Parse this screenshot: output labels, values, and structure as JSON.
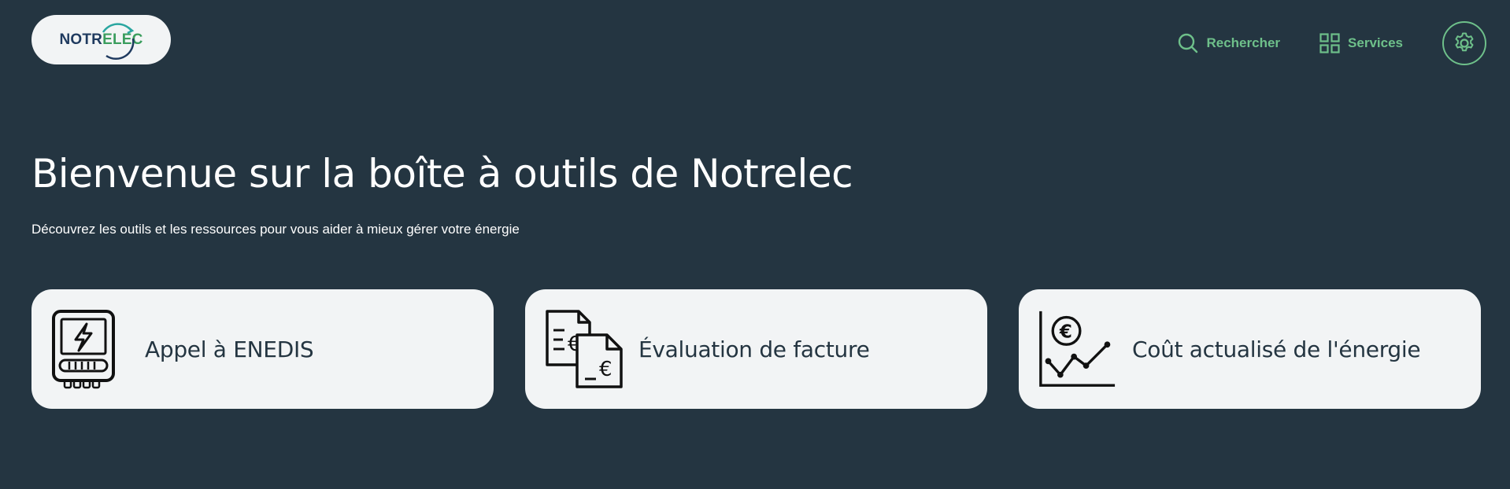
{
  "header": {
    "logo": {
      "text_part_a": "NOTR",
      "text_part_b": "ELEC"
    },
    "nav": {
      "search_label": "Rechercher",
      "search_icon": "search-icon",
      "services_label": "Services",
      "services_icon": "grid-icon",
      "settings_icon": "gear-icon"
    }
  },
  "hero": {
    "title": "Bienvenue sur la boîte à outils de Notrelec",
    "subtitle": "Découvrez les outils et les ressources pour vous aider à mieux gérer votre énergie"
  },
  "cards": [
    {
      "label": "Appel à ENEDIS",
      "icon": "electric-meter-icon"
    },
    {
      "label": "Évaluation de facture",
      "icon": "invoice-euro-icon"
    },
    {
      "label": "Coût actualisé de l'énergie",
      "icon": "euro-chart-icon"
    }
  ],
  "colors": {
    "background": "#243541",
    "accent": "#6ec08a",
    "card_background": "#f2f4f5",
    "card_text": "#243541",
    "logo_blue": "#1f3a5f",
    "logo_green": "#3a9d5d"
  }
}
